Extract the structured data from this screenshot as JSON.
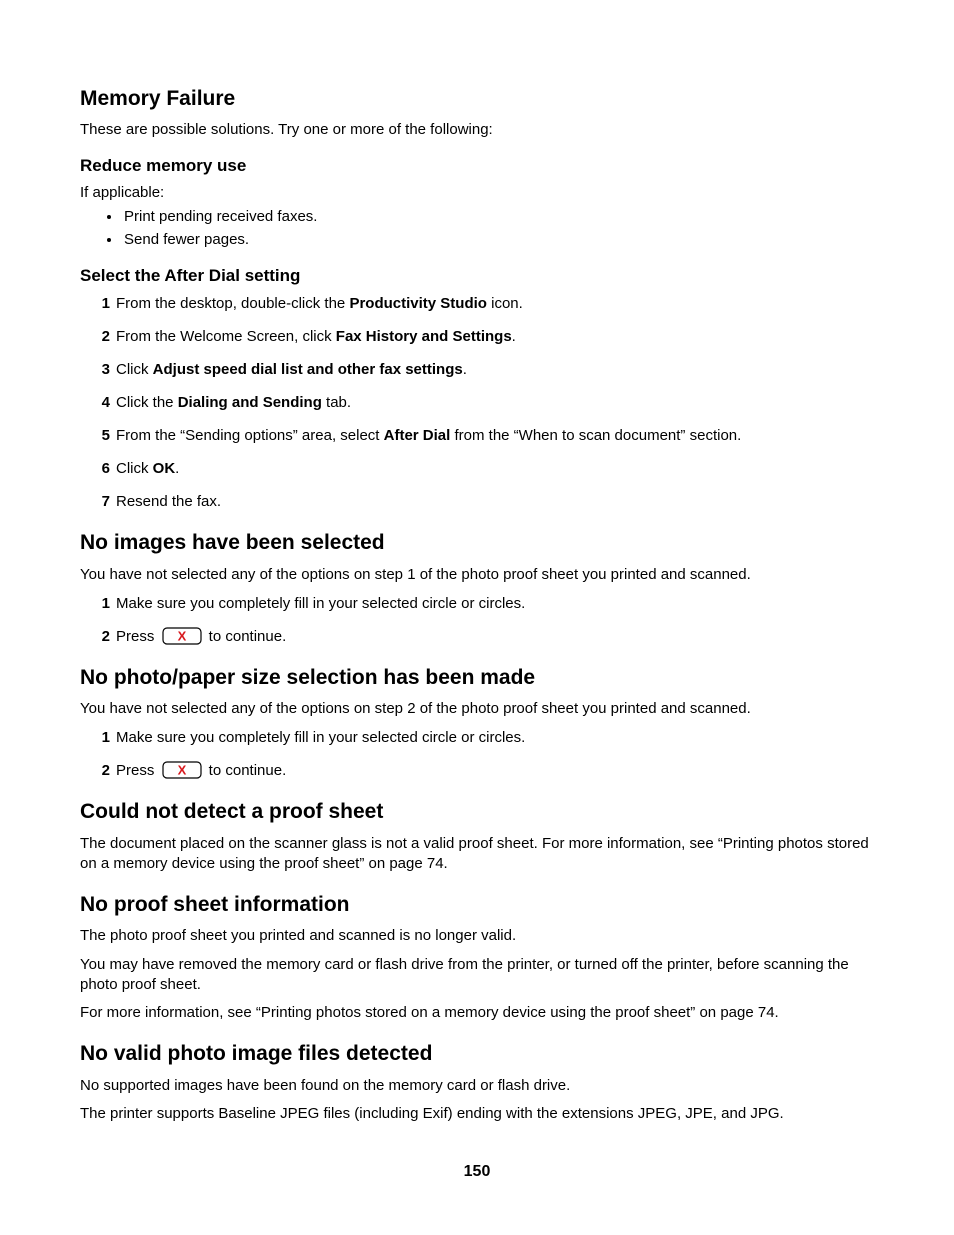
{
  "page_number": "150",
  "memory_failure": {
    "heading": "Memory Failure",
    "intro": "These are possible solutions. Try one or more of the following:",
    "reduce": {
      "heading": "Reduce memory use",
      "lead": "If applicable:",
      "bullets": [
        "Print pending received faxes.",
        "Send fewer pages."
      ]
    },
    "after_dial": {
      "heading": "Select the After Dial setting",
      "steps": [
        {
          "pre": "From the desktop, double-click the ",
          "bold": "Productivity Studio",
          "post": " icon."
        },
        {
          "pre": "From the Welcome Screen, click ",
          "bold": "Fax History and Settings",
          "post": "."
        },
        {
          "pre": "Click ",
          "bold": "Adjust speed dial list and other fax settings",
          "post": "."
        },
        {
          "pre": "Click the ",
          "bold": "Dialing and Sending",
          "post": " tab."
        },
        {
          "pre": "From the “Sending options” area, select ",
          "bold": "After Dial",
          "post": " from the “When to scan document” section."
        },
        {
          "pre": "Click ",
          "bold": "OK",
          "post": "."
        },
        {
          "pre": "Resend the fax.",
          "bold": "",
          "post": ""
        }
      ]
    }
  },
  "no_images": {
    "heading": "No images have been selected",
    "intro": "You have not selected any of the options on step 1 of the photo proof sheet you printed and scanned.",
    "steps": {
      "s1": "Make sure you completely fill in your selected circle or circles.",
      "s2_pre": "Press ",
      "s2_post": " to continue."
    }
  },
  "no_size": {
    "heading": "No photo/paper size selection has been made",
    "intro": "You have not selected any of the options on step 2 of the photo proof sheet you printed and scanned.",
    "steps": {
      "s1": "Make sure you completely fill in your selected circle or circles.",
      "s2_pre": "Press ",
      "s2_post": " to continue."
    }
  },
  "no_detect": {
    "heading": "Could not detect a proof sheet",
    "body": "The document placed on the scanner glass is not a valid proof sheet. For more information, see “Printing photos stored on a memory device using the proof sheet” on page 74."
  },
  "no_proof_info": {
    "heading": "No proof sheet information",
    "p1": "The photo proof sheet you printed and scanned is no longer valid.",
    "p2": "You may have removed the memory card or flash drive from the printer, or turned off the printer, before scanning the photo proof sheet.",
    "p3": "For more information, see “Printing photos stored on a memory device using the proof sheet” on page 74."
  },
  "no_valid": {
    "heading": "No valid photo image files detected",
    "p1": "No supported images have been found on the memory card or flash drive.",
    "p2": "The printer supports Baseline JPEG files (including Exif) ending with the extensions JPEG, JPE, and JPG."
  }
}
